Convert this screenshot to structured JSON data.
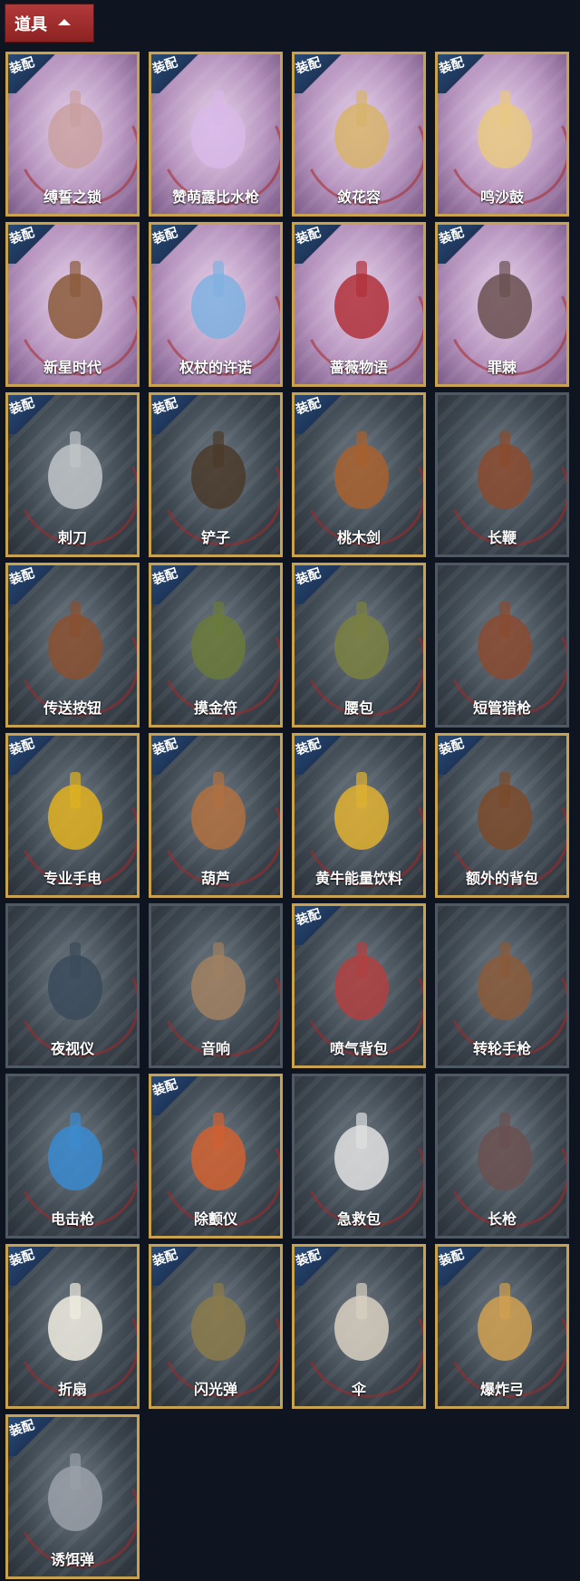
{
  "header": {
    "title": "道具"
  },
  "badge_label": "装配",
  "items": [
    {
      "name": "缚誓之锁",
      "equipped": true,
      "skin": true,
      "icon": "chain-lock-icon"
    },
    {
      "name": "赞萌露比水枪",
      "equipped": true,
      "skin": true,
      "icon": "water-gun-icon"
    },
    {
      "name": "敛花容",
      "equipped": true,
      "skin": true,
      "icon": "flower-chain-icon"
    },
    {
      "name": "鸣沙鼓",
      "equipped": true,
      "skin": true,
      "icon": "drum-icon"
    },
    {
      "name": "新星时代",
      "equipped": true,
      "skin": true,
      "icon": "revolver-icon"
    },
    {
      "name": "权杖的许诺",
      "equipped": true,
      "skin": true,
      "icon": "scepter-icon"
    },
    {
      "name": "蔷薇物语",
      "equipped": true,
      "skin": true,
      "icon": "medkit-icon"
    },
    {
      "name": "罪棘",
      "equipped": true,
      "skin": true,
      "icon": "spear-icon"
    },
    {
      "name": "刺刀",
      "equipped": true,
      "skin": false,
      "icon": "knife-icon"
    },
    {
      "name": "铲子",
      "equipped": true,
      "skin": false,
      "icon": "shovel-icon"
    },
    {
      "name": "桃木剑",
      "equipped": true,
      "skin": false,
      "icon": "wooden-sword-icon"
    },
    {
      "name": "长鞭",
      "equipped": false,
      "skin": false,
      "icon": "whip-icon"
    },
    {
      "name": "传送按钮",
      "equipped": true,
      "skin": false,
      "icon": "remote-icon"
    },
    {
      "name": "摸金符",
      "equipped": true,
      "skin": false,
      "icon": "talisman-icon"
    },
    {
      "name": "腰包",
      "equipped": true,
      "skin": false,
      "icon": "bag-icon"
    },
    {
      "name": "短管猎枪",
      "equipped": false,
      "skin": false,
      "icon": "shotgun-icon"
    },
    {
      "name": "专业手电",
      "equipped": true,
      "skin": false,
      "icon": "flashlight-icon"
    },
    {
      "name": "葫芦",
      "equipped": true,
      "skin": false,
      "icon": "gourd-icon"
    },
    {
      "name": "黄牛能量饮料",
      "equipped": true,
      "skin": false,
      "icon": "energy-drink-icon"
    },
    {
      "name": "额外的背包",
      "equipped": true,
      "skin": false,
      "icon": "backpack-icon"
    },
    {
      "name": "夜视仪",
      "equipped": false,
      "skin": false,
      "icon": "night-vision-icon"
    },
    {
      "name": "音响",
      "equipped": false,
      "skin": false,
      "icon": "radio-icon"
    },
    {
      "name": "喷气背包",
      "equipped": true,
      "skin": false,
      "icon": "jetpack-icon"
    },
    {
      "name": "转轮手枪",
      "equipped": false,
      "skin": false,
      "icon": "revolver-icon"
    },
    {
      "name": "电击枪",
      "equipped": false,
      "skin": false,
      "icon": "taser-icon"
    },
    {
      "name": "除颤仪",
      "equipped": true,
      "skin": false,
      "icon": "defibrillator-icon"
    },
    {
      "name": "急救包",
      "equipped": false,
      "skin": false,
      "icon": "first-aid-icon"
    },
    {
      "name": "长枪",
      "equipped": false,
      "skin": false,
      "icon": "spear-icon"
    },
    {
      "name": "折扇",
      "equipped": true,
      "skin": false,
      "icon": "fan-icon"
    },
    {
      "name": "闪光弹",
      "equipped": true,
      "skin": false,
      "icon": "flashbang-icon"
    },
    {
      "name": "伞",
      "equipped": true,
      "skin": false,
      "icon": "umbrella-icon"
    },
    {
      "name": "爆炸弓",
      "equipped": true,
      "skin": false,
      "icon": "bow-icon"
    },
    {
      "name": "诱饵弹",
      "equipped": true,
      "skin": false,
      "icon": "decoy-icon"
    }
  ]
}
